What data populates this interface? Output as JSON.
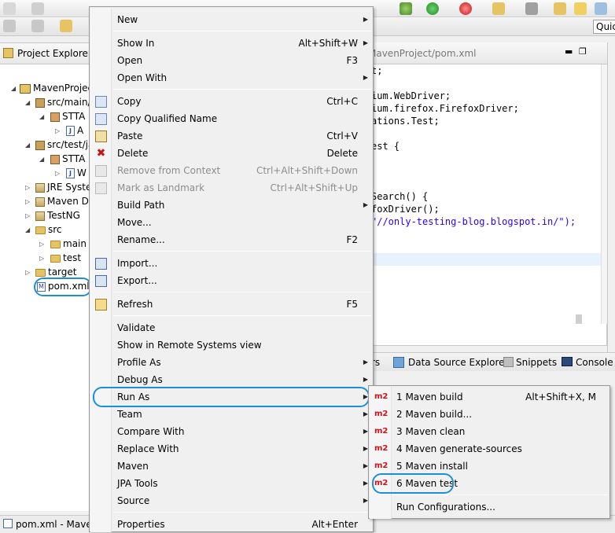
{
  "toolbar": {
    "quick_access": "Quic"
  },
  "explorer": {
    "title": "Project Explorer",
    "items": [
      {
        "label": "MavenProject",
        "type": "project"
      },
      {
        "label": "src/main/java",
        "type": "srcfolder"
      },
      {
        "label": "STTA",
        "type": "package"
      },
      {
        "label": "A",
        "type": "javafile"
      },
      {
        "label": "src/test/java",
        "type": "srcfolder"
      },
      {
        "label": "STTA",
        "type": "package"
      },
      {
        "label": "W",
        "type": "javafile"
      },
      {
        "label": "JRE System Library",
        "type": "library"
      },
      {
        "label": "Maven Dependencies",
        "type": "library"
      },
      {
        "label": "TestNG",
        "type": "library"
      },
      {
        "label": "src",
        "type": "folder"
      },
      {
        "label": "main",
        "type": "folder"
      },
      {
        "label": "test",
        "type": "folder"
      },
      {
        "label": "target",
        "type": "folder"
      },
      {
        "label": "pom.xml",
        "type": "xmlfile"
      }
    ]
  },
  "editor": {
    "tab_title": "MavenProject/pom.xml",
    "code_lines": [
      "t;",
      "",
      "ium.WebDriver;",
      "ium.firefox.FirefoxDriver;",
      "ations.Test;",
      "",
      "est {",
      "",
      "",
      "",
      "Search() {",
      "foxDriver();",
      "\"//only-testing-blog.blogspot.in/\");"
    ]
  },
  "bottom_tabs": {
    "partial": "rs",
    "data_source": "Data Source Explorer",
    "snippets": "Snippets",
    "console": "Console"
  },
  "status": {
    "left": "pom.xml - MavenP"
  },
  "context_menu": {
    "items": [
      {
        "label": "New",
        "accel": "",
        "submenu": true,
        "disabled": false,
        "icon": ""
      },
      {
        "sep": true
      },
      {
        "label": "Show In",
        "accel": "Alt+Shift+W",
        "submenu": true,
        "disabled": false,
        "icon": ""
      },
      {
        "label": "Open",
        "accel": "F3",
        "submenu": false,
        "disabled": false,
        "icon": ""
      },
      {
        "label": "Open With",
        "accel": "",
        "submenu": true,
        "disabled": false,
        "icon": ""
      },
      {
        "sep": true
      },
      {
        "label": "Copy",
        "accel": "Ctrl+C",
        "submenu": false,
        "disabled": false,
        "icon": "copy-icon"
      },
      {
        "label": "Copy Qualified Name",
        "accel": "",
        "submenu": false,
        "disabled": false,
        "icon": "copy-qualified-icon"
      },
      {
        "label": "Paste",
        "accel": "Ctrl+V",
        "submenu": false,
        "disabled": false,
        "icon": "paste-icon"
      },
      {
        "label": "Delete",
        "accel": "Delete",
        "submenu": false,
        "disabled": false,
        "icon": "delete-icon"
      },
      {
        "label": "Remove from Context",
        "accel": "Ctrl+Alt+Shift+Down",
        "submenu": false,
        "disabled": true,
        "icon": "remove-context-icon"
      },
      {
        "label": "Mark as Landmark",
        "accel": "Ctrl+Alt+Shift+Up",
        "submenu": false,
        "disabled": true,
        "icon": "landmark-icon"
      },
      {
        "label": "Build Path",
        "accel": "",
        "submenu": true,
        "disabled": false,
        "icon": ""
      },
      {
        "label": "Move...",
        "accel": "",
        "submenu": false,
        "disabled": false,
        "icon": ""
      },
      {
        "label": "Rename...",
        "accel": "F2",
        "submenu": false,
        "disabled": false,
        "icon": ""
      },
      {
        "sep": true
      },
      {
        "label": "Import...",
        "accel": "",
        "submenu": false,
        "disabled": false,
        "icon": "import-icon"
      },
      {
        "label": "Export...",
        "accel": "",
        "submenu": false,
        "disabled": false,
        "icon": "export-icon"
      },
      {
        "sep": true
      },
      {
        "label": "Refresh",
        "accel": "F5",
        "submenu": false,
        "disabled": false,
        "icon": "refresh-icon"
      },
      {
        "sep": true
      },
      {
        "label": "Validate",
        "accel": "",
        "submenu": false,
        "disabled": false,
        "icon": ""
      },
      {
        "label": "Show in Remote Systems view",
        "accel": "",
        "submenu": false,
        "disabled": false,
        "icon": ""
      },
      {
        "label": "Profile As",
        "accel": "",
        "submenu": true,
        "disabled": false,
        "icon": ""
      },
      {
        "label": "Debug As",
        "accel": "",
        "submenu": true,
        "disabled": false,
        "icon": ""
      },
      {
        "label": "Run As",
        "accel": "",
        "submenu": true,
        "disabled": false,
        "icon": "",
        "highlight": true
      },
      {
        "label": "Team",
        "accel": "",
        "submenu": true,
        "disabled": false,
        "icon": ""
      },
      {
        "label": "Compare With",
        "accel": "",
        "submenu": true,
        "disabled": false,
        "icon": ""
      },
      {
        "label": "Replace With",
        "accel": "",
        "submenu": true,
        "disabled": false,
        "icon": ""
      },
      {
        "label": "Maven",
        "accel": "",
        "submenu": true,
        "disabled": false,
        "icon": ""
      },
      {
        "label": "JPA Tools",
        "accel": "",
        "submenu": true,
        "disabled": false,
        "icon": ""
      },
      {
        "label": "Source",
        "accel": "",
        "submenu": true,
        "disabled": false,
        "icon": ""
      },
      {
        "sep": true
      },
      {
        "label": "Properties",
        "accel": "Alt+Enter",
        "submenu": false,
        "disabled": false,
        "icon": ""
      }
    ]
  },
  "run_as_submenu": {
    "items": [
      {
        "badge": "m2",
        "label": "1 Maven build",
        "accel": "Alt+Shift+X, M"
      },
      {
        "badge": "m2",
        "label": "2 Maven build...",
        "accel": ""
      },
      {
        "badge": "m2",
        "label": "3 Maven clean",
        "accel": ""
      },
      {
        "badge": "m2",
        "label": "4 Maven generate-sources",
        "accel": ""
      },
      {
        "badge": "m2",
        "label": "5 Maven install",
        "accel": ""
      },
      {
        "badge": "m2",
        "label": "6 Maven test",
        "accel": "",
        "highlight": true
      },
      {
        "sep": true
      },
      {
        "badge": "",
        "label": "Run Configurations...",
        "accel": ""
      }
    ]
  },
  "colors": {
    "accent_oval": "#1e8fd6",
    "m2_red": "#d4111a",
    "menu_bg": "#f0f0f0"
  }
}
